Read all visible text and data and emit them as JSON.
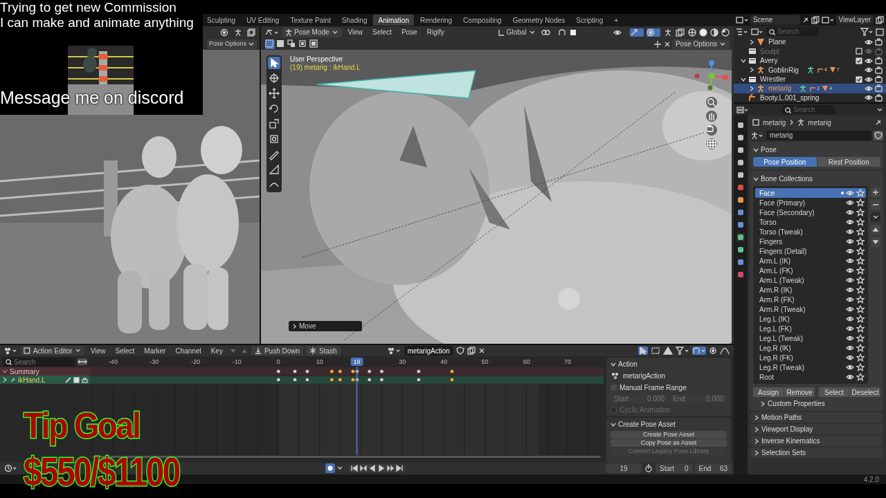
{
  "overlay": {
    "lines": [
      "Trying to get new Commission",
      "I can make and animate anything"
    ],
    "message": "Message me on discord",
    "tip_title": "Tip Goal",
    "tip_amount": "$550/$1100"
  },
  "workspace_tabs": [
    {
      "label": "Sculpting",
      "selected": false
    },
    {
      "label": "UV Editing",
      "selected": false
    },
    {
      "label": "Texture Paint",
      "selected": false
    },
    {
      "label": "Shading",
      "selected": false
    },
    {
      "label": "Animation",
      "selected": true
    },
    {
      "label": "Rendering",
      "selected": false
    },
    {
      "label": "Compositing",
      "selected": false
    },
    {
      "label": "Geometry Nodes",
      "selected": false
    },
    {
      "label": "Scripting",
      "selected": false
    },
    {
      "label": "+",
      "selected": false
    }
  ],
  "left_viewport": {
    "pose_options": "Pose Options"
  },
  "viewport": {
    "mode": "Pose Mode",
    "menus": [
      "View",
      "Select",
      "Pose",
      "Rigify"
    ],
    "orientation": "Global",
    "pose_options": "Pose Options",
    "view_name": "User Perspective",
    "active": "(19) metarig : ikHand.L",
    "last_operator": "Move",
    "tools": [
      {
        "kind": "select",
        "selected": true
      },
      {
        "kind": "cursor",
        "selected": false
      },
      {
        "kind": "move",
        "selected": false
      },
      {
        "kind": "rotate",
        "selected": false
      },
      {
        "kind": "scale",
        "selected": false
      },
      {
        "kind": "transform",
        "selected": false
      },
      {
        "kind": "annotate",
        "selected": false
      },
      {
        "kind": "measure",
        "selected": false
      },
      {
        "kind": "bend",
        "selected": false
      }
    ]
  },
  "outliner": {
    "scene": "Scene",
    "view_layer": "ViewLayer",
    "search_placeholder": "Search",
    "items": [
      {
        "label": "Plane",
        "kind": "mesh",
        "expanded": false,
        "selected": false
      },
      {
        "label": "Sculpt",
        "kind": "collection",
        "checked": false,
        "selected": false
      },
      {
        "label": "Avery",
        "kind": "collection",
        "checked": true,
        "expanded": true,
        "selected": false,
        "children": [
          {
            "label": "GoblinRig",
            "kind": "armature",
            "expanded": false,
            "selected": false,
            "badges": [
              "4",
              "7"
            ]
          }
        ]
      },
      {
        "label": "Wrestler",
        "kind": "collection",
        "checked": true,
        "expanded": true,
        "selected": false,
        "children": [
          {
            "label": "metarig",
            "kind": "armature",
            "expanded": false,
            "selected": true,
            "badges": [
              "2",
              "4"
            ]
          }
        ]
      },
      {
        "label": "Booty.L.001_spring",
        "kind": "bone",
        "selected": false
      }
    ]
  },
  "properties": {
    "search_placeholder": "Search",
    "breadcrumb": [
      "metarig",
      "metarig"
    ],
    "object_name": "metarig",
    "pose_header": "Pose",
    "pose_positions": [
      {
        "label": "Pose Position",
        "selected": true
      },
      {
        "label": "Rest Position",
        "selected": false
      }
    ],
    "bone_collections_header": "Bone Collections",
    "bone_collections": [
      {
        "label": "Face",
        "selected": true
      },
      {
        "label": "Face (Primary)",
        "selected": false
      },
      {
        "label": "Face (Secondary)",
        "selected": false
      },
      {
        "label": "Torso",
        "selected": false
      },
      {
        "label": "Torso (Tweak)",
        "selected": false
      },
      {
        "label": "Fingers",
        "selected": false
      },
      {
        "label": "Fingers (Detail)",
        "selected": false
      },
      {
        "label": "Arm.L (IK)",
        "selected": false
      },
      {
        "label": "Arm.L (FK)",
        "selected": false
      },
      {
        "label": "Arm.L (Tweak)",
        "selected": false
      },
      {
        "label": "Arm.R (IK)",
        "selected": false
      },
      {
        "label": "Arm.R (FK)",
        "selected": false
      },
      {
        "label": "Arm.R (Tweak)",
        "selected": false
      },
      {
        "label": "Leg.L (IK)",
        "selected": false
      },
      {
        "label": "Leg.L (FK)",
        "selected": false
      },
      {
        "label": "Leg.L (Tweak)",
        "selected": false
      },
      {
        "label": "Leg.R (IK)",
        "selected": false
      },
      {
        "label": "Leg.R (FK)",
        "selected": false
      },
      {
        "label": "Leg.R (Tweak)",
        "selected": false
      },
      {
        "label": "Root",
        "selected": false
      }
    ],
    "collection_buttons": [
      "Assign",
      "Remove",
      "Select",
      "Deselect"
    ],
    "custom_properties": "Custom Properties",
    "panels": [
      "Motion Paths",
      "Viewport Display",
      "Inverse Kinematics",
      "Selection Sets"
    ]
  },
  "action_editor": {
    "mode": "Action Editor",
    "menus": [
      "View",
      "Select",
      "Marker",
      "Channel",
      "Key"
    ],
    "push_down": "Push Down",
    "stash": "Stash",
    "action": "metarigAction",
    "search_placeholder": "Search",
    "ruler": [
      {
        "label": "-40",
        "level": 0.045
      },
      {
        "label": "-30",
        "level": 0.125
      },
      {
        "label": "-20",
        "level": 0.206
      },
      {
        "label": "-10",
        "level": 0.286
      },
      {
        "label": "0",
        "level": 0.367
      },
      {
        "label": "10",
        "level": 0.447
      },
      {
        "label": "30",
        "level": 0.608
      },
      {
        "label": "40",
        "level": 0.689
      },
      {
        "label": "50",
        "level": 0.769
      },
      {
        "label": "60",
        "level": 0.85
      },
      {
        "label": "70",
        "level": 0.93
      }
    ],
    "current_frame": "19",
    "channels": [
      {
        "label": "Summary",
        "kind": "summary",
        "keyframes": [
          {
            "selected": false,
            "level": 0.367
          },
          {
            "selected": false,
            "level": 0.399
          },
          {
            "selected": false,
            "level": 0.423
          },
          {
            "selected": true,
            "level": 0.471
          },
          {
            "selected": true,
            "level": 0.487
          },
          {
            "selected": true,
            "level": 0.512
          },
          {
            "selected": false,
            "level": 0.52
          },
          {
            "selected": false,
            "level": 0.544
          },
          {
            "selected": false,
            "level": 0.568
          },
          {
            "selected": false,
            "level": 0.64
          },
          {
            "selected": true,
            "level": 0.705
          }
        ]
      },
      {
        "label": "ikHand.L",
        "kind": "bone",
        "keyframes": [
          {
            "selected": false,
            "level": 0.367
          },
          {
            "selected": false,
            "level": 0.399
          },
          {
            "selected": false,
            "level": 0.423
          },
          {
            "selected": true,
            "level": 0.471
          },
          {
            "selected": true,
            "level": 0.487
          },
          {
            "selected": true,
            "level": 0.512
          },
          {
            "selected": false,
            "level": 0.52
          },
          {
            "selected": false,
            "level": 0.544
          },
          {
            "selected": false,
            "level": 0.568
          },
          {
            "selected": false,
            "level": 0.64
          },
          {
            "selected": true,
            "level": 0.705
          }
        ]
      }
    ]
  },
  "action_panel": {
    "header": "Action",
    "action": "metarigAction",
    "manual_frame_range": {
      "label": "Manual Frame Range",
      "checked": false
    },
    "start_label": "Start",
    "start": "0.000",
    "end_label": "End",
    "end": "0.000",
    "cyclic": {
      "label": "Cyclic Animation",
      "checked": false,
      "disabled": true
    },
    "pose_asset_header": "Create Pose Asset",
    "buttons": [
      {
        "label": "Create Pose Asset",
        "disabled": false
      },
      {
        "label": "Copy Pose as Asset",
        "disabled": false
      },
      {
        "label": "Convert Legacy Pose Library",
        "disabled": true
      }
    ]
  },
  "timeline": {
    "current_frame": "19",
    "start_label": "Start",
    "start": "0",
    "end_label": "End",
    "end": "63"
  },
  "status_bar": {
    "version": "4.2.0"
  }
}
